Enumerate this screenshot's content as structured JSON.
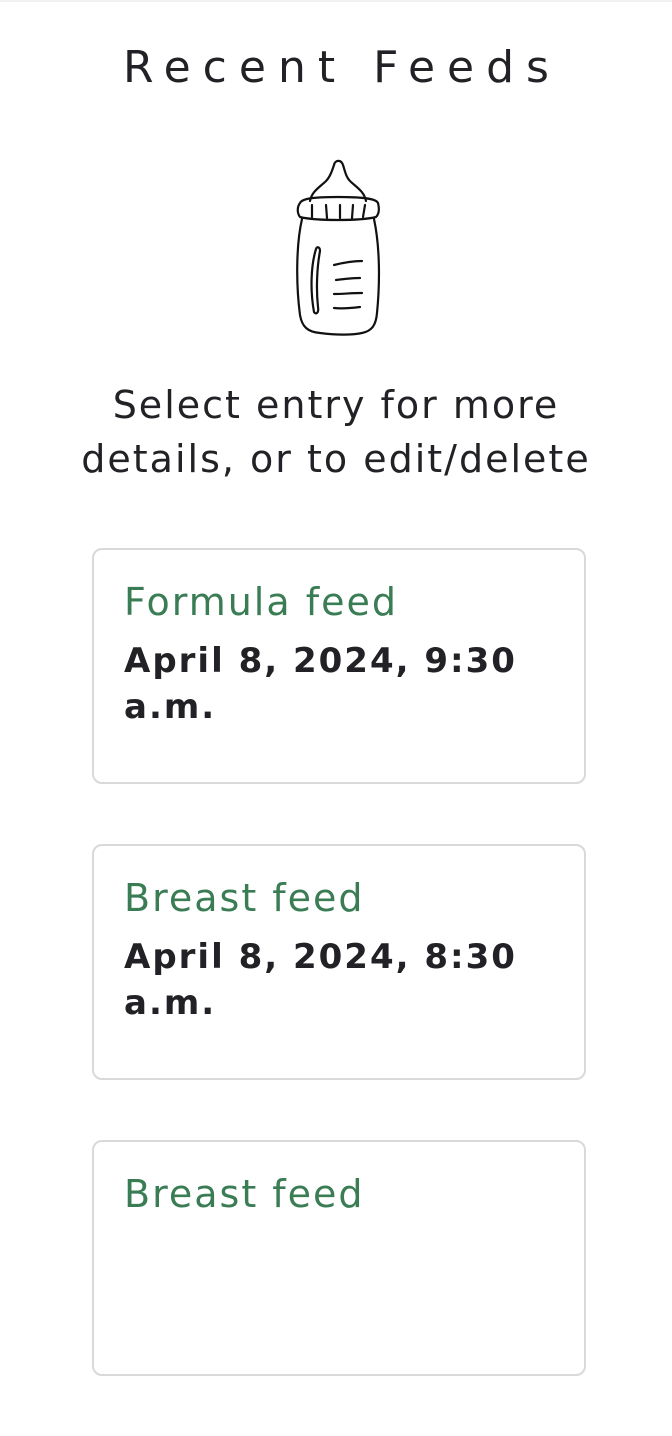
{
  "page": {
    "title": "Recent Feeds",
    "instructions": "Select entry for more details, or to edit/delete"
  },
  "feeds": [
    {
      "type": "Formula feed",
      "time": "April 8, 2024, 9:30 a.m."
    },
    {
      "type": "Breast feed",
      "time": "April 8, 2024, 8:30 a.m."
    },
    {
      "type": "Breast feed",
      "time": ""
    }
  ],
  "icons": {
    "illustration": "baby-bottle-icon"
  },
  "colors": {
    "feed_type_green": "#3a7d55",
    "text": "#222226",
    "card_border": "#d9d9d9"
  }
}
